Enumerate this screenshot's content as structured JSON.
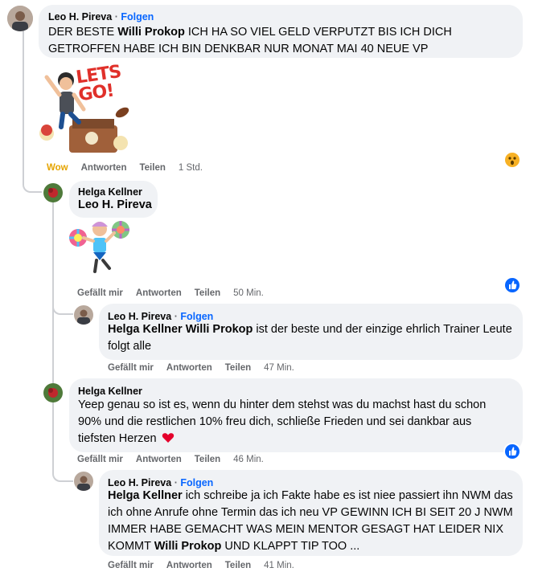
{
  "follow_label": "Folgen",
  "comments": [
    {
      "author": "Leo H. Pireva",
      "text_parts": [
        "DER BESTE ",
        "Willi Prokop",
        " ICH HA SO VIEL GELD VERPUTZT BIS ICH DICH GETROFFEN HABE ICH BIN DENKBAR NUR MONAT MAI 40 NEUE VP"
      ],
      "sticker_text": "LETS GO!",
      "reaction_label": "Wow",
      "reply_label": "Antworten",
      "share_label": "Teilen",
      "time": "1 Std.",
      "reaction_icon": "wow-face-icon"
    },
    {
      "author": "Helga Kellner",
      "mention": "Leo H. Pireva",
      "like_label": "Gefällt mir",
      "reply_label": "Antworten",
      "share_label": "Teilen",
      "time": "50 Min.",
      "reaction_icon": "like-thumb-icon"
    },
    {
      "author": "Leo H. Pireva",
      "text_parts": [
        "Helga Kellner",
        " ",
        "Willi Prokop",
        " ist der beste und der einzige ehrlich Trainer Leute folgt alle"
      ],
      "like_label": "Gefällt mir",
      "reply_label": "Antworten",
      "share_label": "Teilen",
      "time": "47 Min."
    },
    {
      "author": "Helga Kellner",
      "text": "Yeep genau so ist es, wenn du hinter dem stehst was du machst hast du schon 90% und die restlichen 10% freu dich, schließe Frieden und sei dankbar aus tiefsten Herzen",
      "like_label": "Gefällt mir",
      "reply_label": "Antworten",
      "share_label": "Teilen",
      "time": "46 Min.",
      "reaction_icon": "like-thumb-icon"
    },
    {
      "author": "Leo H. Pireva",
      "text_parts": [
        "Helga Kellner",
        " ich schreibe ja ich Fakte habe es ist niee passiert ihn NWM das ich ohne Anrufe ohne Termin das ich neu VP GEWINN ICH BI SEIT 20 J NWM IMMER HABE GEMACHT WAS MEIN MENTOR GESAGT HAT LEIDER NIX KOMMT ",
        "Willi Prokop",
        " UND KLAPPT TIP TOO ..."
      ],
      "like_label": "Gefällt mir",
      "reply_label": "Antworten",
      "share_label": "Teilen",
      "time": "41 Min."
    }
  ],
  "colors": {
    "link": "#0866ff",
    "wow": "#e5a400",
    "meta": "#65676b",
    "bubble": "#f0f2f5"
  }
}
